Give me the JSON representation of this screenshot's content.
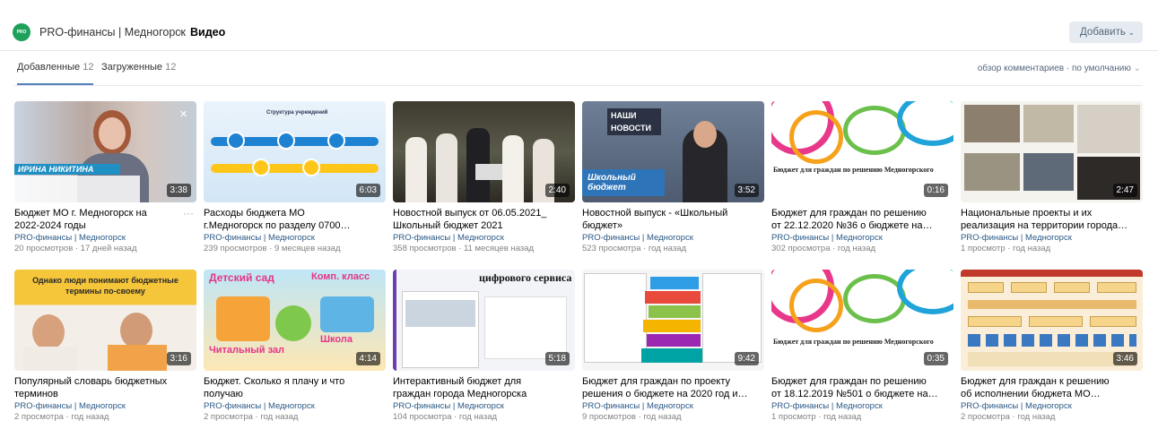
{
  "header": {
    "logo_text": "PRO",
    "community": "PRO-финансы | Медногорск",
    "section": "Видео",
    "add_button": "Добавить"
  },
  "tabs": [
    {
      "label": "Добавленные",
      "count": "12"
    },
    {
      "label": "Загруженные",
      "count": "12"
    }
  ],
  "sort": {
    "label": "обзор комментариев · по умолчанию"
  },
  "videos": [
    {
      "title": "Бюджет МО г. Медногорск на\n2022-2024 годы",
      "channel": "PRO-финансы | Медногорск",
      "meta": "20 просмотров · 17 дней назад",
      "duration": "3:38",
      "overlay": "ИРИНА НИКИТИНА"
    },
    {
      "title": "Расходы бюджета МО\nг.Медногорск по разделу 0700…",
      "channel": "PRO-финансы | Медногорск",
      "meta": "239 просмотров · 9 месяцев назад",
      "duration": "6:03",
      "overlay": "Структура учреждений"
    },
    {
      "title": "Новостной выпуск от 06.05.2021_\nШкольный бюджет 2021",
      "channel": "PRO-финансы | Медногорск",
      "meta": "358 просмотров · 11 месяцев назад",
      "duration": "2:40",
      "overlay": ""
    },
    {
      "title": "Новостной выпуск - «Школьный\nбюджет»",
      "channel": "PRO-финансы | Медногорск",
      "meta": "523 просмотра · год назад",
      "duration": "3:52",
      "overlay": "Школьный бюджет"
    },
    {
      "title": "Бюджет для граждан по решению\nот 22.12.2020 №36 о бюджете на…",
      "channel": "PRO-финансы | Медногорск",
      "meta": "302 просмотра · год назад",
      "duration": "0:16",
      "overlay": "Бюджет для граждан по решению Медногорского"
    },
    {
      "title": "Национальные проекты и их\nреализация на территории города…",
      "channel": "PRO-финансы | Медногорск",
      "meta": "1 просмотр · год назад",
      "duration": "2:47",
      "overlay": ""
    },
    {
      "title": "Популярный словарь бюджетных\nтерминов",
      "channel": "PRO-финансы | Медногорск",
      "meta": "2 просмотра · год назад",
      "duration": "3:16",
      "overlay": "Однако люди понимают бюджетные термины по-своему"
    },
    {
      "title": "Бюджет. Сколько я плачу и что\nполучаю",
      "channel": "PRO-финансы | Медногорск",
      "meta": "2 просмотра · год назад",
      "duration": "4:14",
      "overlay": "Детский сад"
    },
    {
      "title": "Интерактивный бюджет для\nграждан города Медногорска",
      "channel": "PRO-финансы | Медногорск",
      "meta": "104 просмотра · год назад",
      "duration": "5:18",
      "overlay": "цифрового сервиса"
    },
    {
      "title": "Бюджет для граждан по проекту\nрешения о бюджете на 2020 год и…",
      "channel": "PRO-финансы | Медногорск",
      "meta": "9 просмотров · год назад",
      "duration": "9:42",
      "overlay": ""
    },
    {
      "title": "Бюджет для граждан по решению\nот 18.12.2019 №501 о бюджете на…",
      "channel": "PRO-финансы | Медногорск",
      "meta": "1 просмотр · год назад",
      "duration": "0:35",
      "overlay": "Бюджет для граждан по решению Медногорского"
    },
    {
      "title": "Бюджет для граждан к решению\nоб исполнении бюджета МО…",
      "channel": "PRO-финансы | Медногорск",
      "meta": "2 просмотра · год назад",
      "duration": "3:46",
      "overlay": ""
    }
  ],
  "colors": {
    "accent": "#5181b8",
    "link": "#2a5885",
    "muted": "#828282"
  }
}
